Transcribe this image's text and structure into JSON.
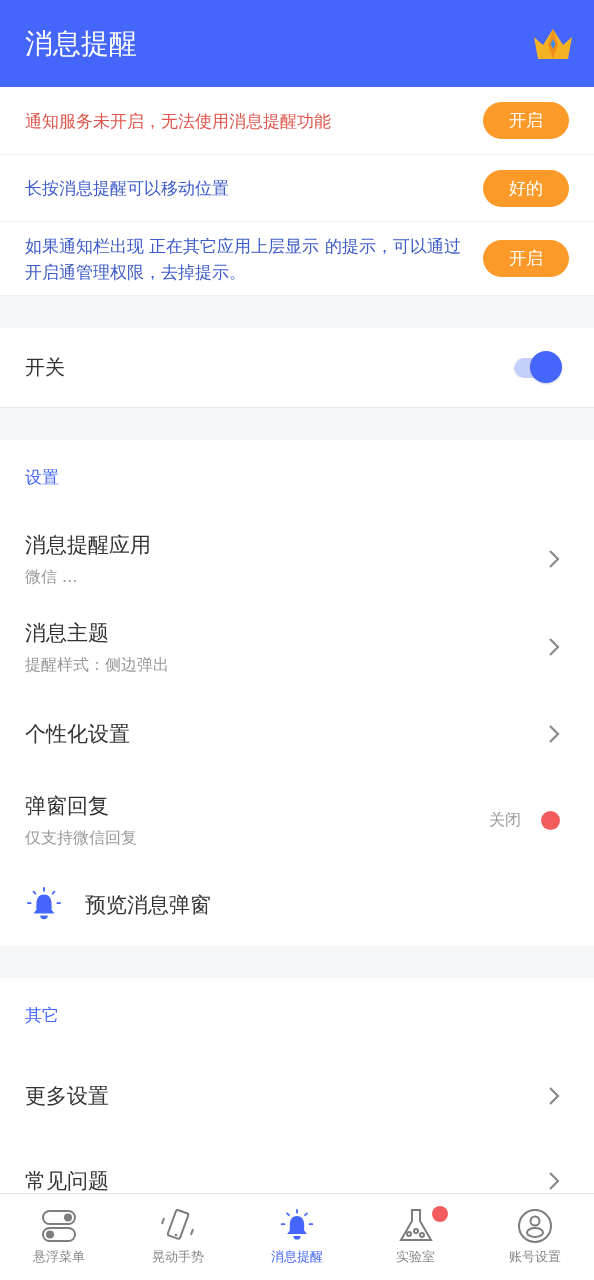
{
  "header": {
    "title": "消息提醒"
  },
  "notices": [
    {
      "kind": "warning",
      "text": "通知服务未开启，无法使用消息提醒功能",
      "button": "开启"
    },
    {
      "kind": "info",
      "text": "长按消息提醒可以移动位置",
      "button": "好的"
    },
    {
      "kind": "info",
      "text": "如果通知栏出现 正在其它应用上层显示 的提示，可以通过开启通管理权限，去掉提示。",
      "button": "开启"
    }
  ],
  "master_switch": {
    "label": "开关",
    "on": true
  },
  "sections": [
    {
      "heading": "设置",
      "items": [
        {
          "kind": "link",
          "title": "消息提醒应用",
          "subtitle": "微信 ..."
        },
        {
          "kind": "link",
          "title": "消息主题",
          "subtitle": "提醒样式：侧边弹出"
        },
        {
          "kind": "link",
          "title": "个性化设置"
        },
        {
          "kind": "status",
          "title": "弹窗回复",
          "subtitle": "仅支持微信回复",
          "status": "关闭",
          "on": false
        },
        {
          "kind": "action",
          "title": "预览消息弹窗"
        }
      ]
    },
    {
      "heading": "其它",
      "items": [
        {
          "kind": "link",
          "title": "更多设置"
        },
        {
          "kind": "link",
          "title": "常见问题"
        }
      ]
    }
  ],
  "bottom_nav": [
    {
      "label": "悬浮菜单",
      "selected": false,
      "badge": false
    },
    {
      "label": "晃动手势",
      "selected": false,
      "badge": false
    },
    {
      "label": "消息提醒",
      "selected": true,
      "badge": false
    },
    {
      "label": "实验室",
      "selected": false,
      "badge": true
    },
    {
      "label": "账号设置",
      "selected": false,
      "badge": false
    }
  ]
}
